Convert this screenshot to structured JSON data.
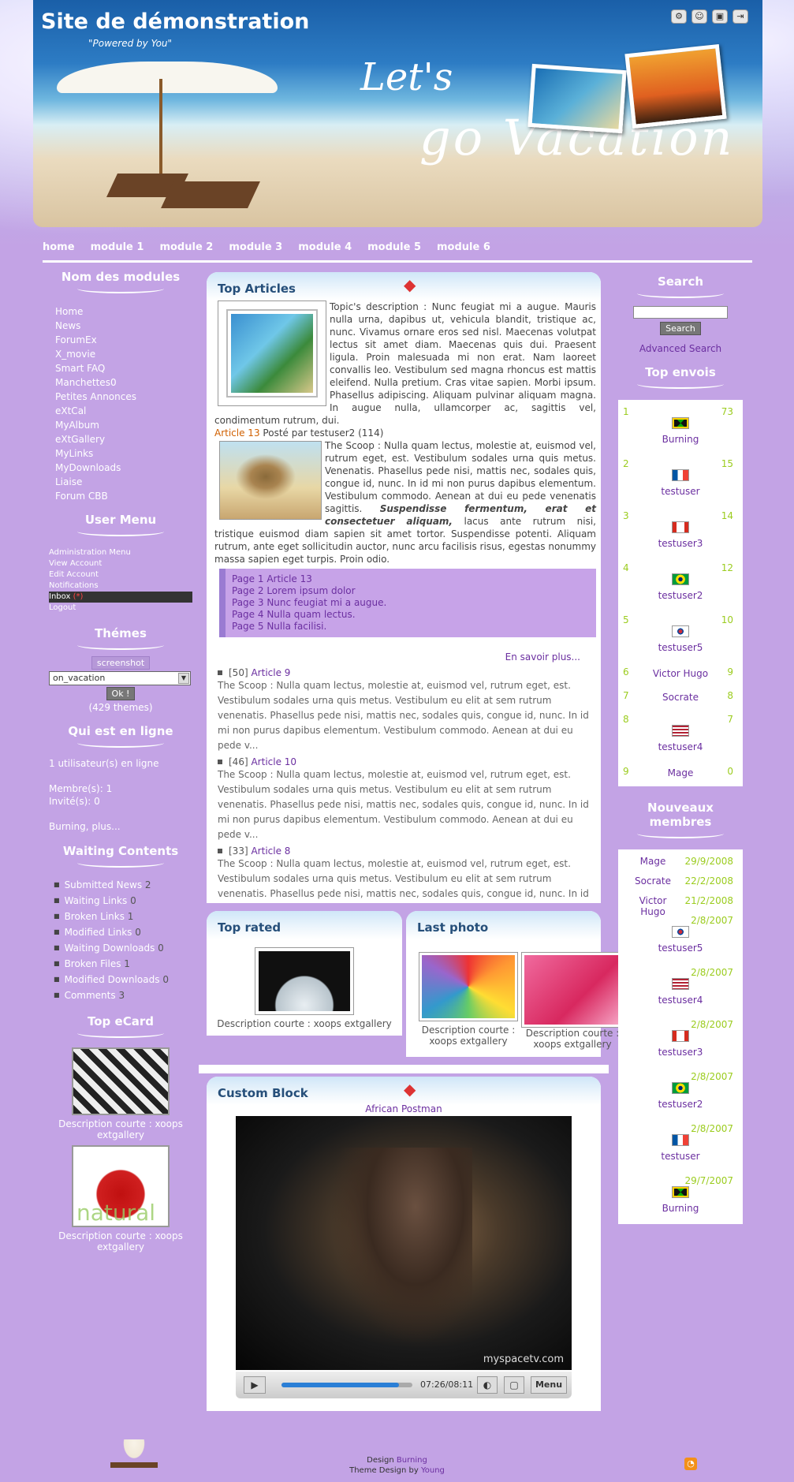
{
  "header": {
    "site_title": "Site de démonstration",
    "slogan": "\"Powered by You\"",
    "banner_line1": "Let's",
    "banner_line2": "go Vacation"
  },
  "nav": [
    "home",
    "module 1",
    "module 2",
    "module 3",
    "module 4",
    "module 5",
    "module 6"
  ],
  "left": {
    "modules_title": "Nom des modules",
    "modules": [
      "Home",
      "News",
      "ForumEx",
      "X_movie",
      "Smart FAQ",
      "Manchettes0",
      "Petites Annonces",
      "eXtCal",
      "MyAlbum",
      "eXtGallery",
      "MyLinks",
      "MyDownloads",
      "Liaise",
      "Forum CBB"
    ],
    "usermenu_title": "User Menu",
    "usermenu": [
      "Administration Menu",
      "View Account",
      "Edit Account",
      "Notifications",
      "Inbox",
      "Logout"
    ],
    "inbox_count": "(*)",
    "themes_title": "Thémes",
    "screenshot_label": "screenshot",
    "theme_selected": "on_vacation",
    "ok_label": "Ok !",
    "themes_count": "(429 themes)",
    "online_title": "Qui est en ligne",
    "online_count": "1 utilisateur(s) en ligne",
    "members": "Membre(s): 1",
    "guests": "Invité(s): 0",
    "online_names": "Burning, plus...",
    "waiting_title": "Waiting Contents",
    "waiting": [
      {
        "label": "Submitted News",
        "n": "2"
      },
      {
        "label": "Waiting Links",
        "n": "0"
      },
      {
        "label": "Broken Links",
        "n": "1"
      },
      {
        "label": "Modified Links",
        "n": "0"
      },
      {
        "label": "Waiting Downloads",
        "n": "0"
      },
      {
        "label": "Broken Files",
        "n": "1"
      },
      {
        "label": "Modified Downloads",
        "n": "0"
      },
      {
        "label": "Comments",
        "n": "3"
      }
    ],
    "ecard_title": "Top eCard",
    "ecard_caption": "Description courte : xoops extgallery",
    "ecard_natural": "natural"
  },
  "top_articles": {
    "title": "Top Articles",
    "intro": "Topic's description : Nunc feugiat mi a augue. Mauris nulla urna, dapibus ut, vehicula blandit, tristique ac, nunc. Vivamus ornare eros sed nisl. Maecenas volutpat lectus sit amet diam. Maecenas quis dui. Praesent ligula. Proin malesuada mi non erat. Nam laoreet convallis leo. Vestibulum sed magna rhoncus est mattis eleifend. Nulla pretium. Cras vitae sapien. Morbi ipsum. Phasellus adipiscing. Aliquam pulvinar aliquam magna. In augue nulla, ullamcorper ac, sagittis vel, condimentum rutrum, dui.",
    "article_link": "Article 13",
    "article_meta": "Posté par testuser2 (114)",
    "scoop_part1": "The Scoop : Nulla quam lectus, molestie at, euismod vel, rutrum eget, est. Vestibulum sodales urna quis metus. Venenatis. Phasellus pede nisi, mattis nec, sodales quis, congue id, nunc. In id mi non purus dapibus elementum. Vestibulum commodo. Aenean at dui eu pede venenatis sagittis.",
    "scoop_bold": "Suspendisse fermentum, erat et consectetuer aliquam,",
    "scoop_part2": "lacus ante rutrum nisi, tristique euismod diam sapien sit amet tortor. Suspendisse potenti. Aliquam rutrum, ante eget sollicitudin auctor, nunc arcu facilisis risus, egestas nonummy massa sapien eget turpis. Proin odio.",
    "pages": [
      "Page 1 Article 13",
      "Page 2 Lorem ipsum dolor",
      "Page 3 Nunc feugiat mi a augue.",
      "Page 4 Nulla quam lectus.",
      "Page 5 Nulla facilisi."
    ],
    "more": "En savoir plus...",
    "items": [
      {
        "num": "[50]",
        "link": "Article 9",
        "text": "The Scoop : Nulla quam lectus, molestie at, euismod vel, rutrum eget, est. Vestibulum sodales urna quis metus. Vestibulum eu elit at sem rutrum venenatis. Phasellus pede nisi, mattis nec, sodales quis, congue id, nunc. In id mi non purus dapibus elementum. Vestibulum commodo. Aenean at dui eu pede v..."
      },
      {
        "num": "[46]",
        "link": "Article 10",
        "text": "The Scoop : Nulla quam lectus, molestie at, euismod vel, rutrum eget, est. Vestibulum sodales urna quis metus. Vestibulum eu elit at sem rutrum venenatis. Phasellus pede nisi, mattis nec, sodales quis, congue id, nunc. In id mi non purus dapibus elementum. Vestibulum commodo. Aenean at dui eu pede v..."
      },
      {
        "num": "[33]",
        "link": "Article 8",
        "text": "The Scoop : Nulla quam lectus, molestie at, euismod vel, rutrum eget, est. Vestibulum sodales urna quis metus. Vestibulum eu elit at sem rutrum venenatis. Phasellus pede nisi, mattis nec, sodales quis, congue id, nunc. In id mi non purus dapibus elementum. Vestibulum commodo. Aenean at dui eu pede v..."
      }
    ]
  },
  "top_rated": {
    "title": "Top rated",
    "caption": "Description courte : xoops extgallery"
  },
  "last_photo": {
    "title": "Last photo",
    "caption1": "Description courte : xoops extgallery",
    "caption2": "Description courte : xoops extgallery"
  },
  "custom_block": {
    "title": "Custom Block",
    "video_title": "African Postman",
    "watermark": "myspacetv.com",
    "time": "07:26/08:11",
    "menu": "Menu",
    "progress": 0.9
  },
  "right": {
    "search_title": "Search",
    "search_button": "Search",
    "advanced": "Advanced Search",
    "topsend_title": "Top envois",
    "topsend": [
      {
        "rank": "1",
        "name": "Burning",
        "count": "73",
        "flag": "jm"
      },
      {
        "rank": "2",
        "name": "testuser",
        "count": "15",
        "flag": "fr"
      },
      {
        "rank": "3",
        "name": "testuser3",
        "count": "14",
        "flag": "ca"
      },
      {
        "rank": "4",
        "name": "testuser2",
        "count": "12",
        "flag": "br"
      },
      {
        "rank": "5",
        "name": "testuser5",
        "count": "10",
        "flag": "kr"
      },
      {
        "rank": "6",
        "name": "Victor Hugo",
        "count": "9",
        "flag": ""
      },
      {
        "rank": "7",
        "name": "Socrate",
        "count": "8",
        "flag": ""
      },
      {
        "rank": "8",
        "name": "testuser4",
        "count": "7",
        "flag": "us"
      },
      {
        "rank": "9",
        "name": "Mage",
        "count": "0",
        "flag": ""
      }
    ],
    "newmembers_title": "Nouveaux membres",
    "newmembers": [
      {
        "name": "Mage",
        "date": "29/9/2008",
        "flag": ""
      },
      {
        "name": "Socrate",
        "date": "22/2/2008",
        "flag": ""
      },
      {
        "name": "Victor Hugo",
        "date": "21/2/2008",
        "flag": ""
      },
      {
        "name": "testuser5",
        "date": "2/8/2007",
        "flag": "kr"
      },
      {
        "name": "testuser4",
        "date": "2/8/2007",
        "flag": "us"
      },
      {
        "name": "testuser3",
        "date": "2/8/2007",
        "flag": "ca"
      },
      {
        "name": "testuser2",
        "date": "2/8/2007",
        "flag": "br"
      },
      {
        "name": "testuser",
        "date": "2/8/2007",
        "flag": "fr"
      },
      {
        "name": "Burning",
        "date": "29/7/2007",
        "flag": "jm"
      }
    ]
  },
  "footer": {
    "design_label": "Design",
    "design_by": "Burning",
    "theme_label": "Theme Design",
    "by": "by",
    "theme_by": "Young"
  },
  "colors": {
    "background": "#c3a3e5",
    "link": "#6b2fa0",
    "green": "#9bcc1e",
    "header_blue": "#1a5fa8"
  }
}
